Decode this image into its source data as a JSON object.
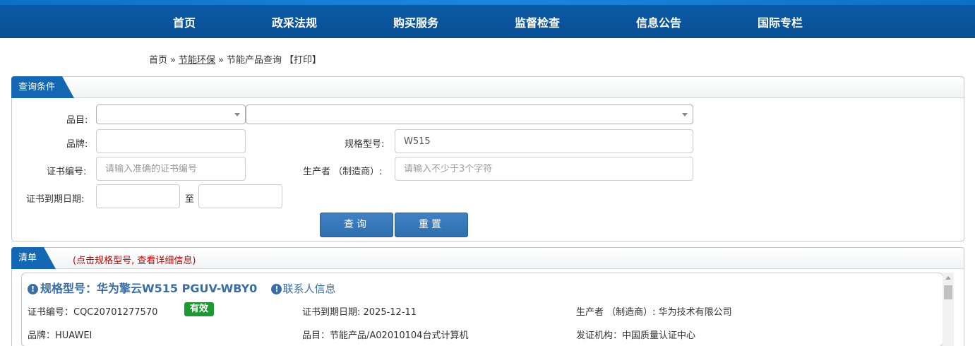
{
  "nav": {
    "items": [
      "首页",
      "政采法规",
      "购买服务",
      "监督检查",
      "信息公告",
      "国际专栏"
    ]
  },
  "breadcrumb": {
    "home": "首页",
    "sep": "»",
    "section": "节能环保",
    "current": "节能产品查询",
    "print": "【打印】"
  },
  "query": {
    "tab": "查询条件",
    "category_label": "品目:",
    "brand_label": "品牌:",
    "model_label": "规格型号:",
    "model_value": "W515",
    "cert_label": "证书编号:",
    "cert_placeholder": "请输入准确的证书编号",
    "maker_label": "生产者 （制造商）:",
    "maker_placeholder": "请输入不少于3个字符",
    "date_label": "证书到期日期:",
    "date_to": "至",
    "search_button": "查询",
    "reset_button": "重置"
  },
  "list": {
    "tab": "清单",
    "hint": "(点击规格型号, 查看详细信息)",
    "items": [
      {
        "model": "规格型号：华为擎云W515 PGUV-WBY0",
        "contact": "联系人信息",
        "cert_no": "证书编号：CQC20701277570",
        "status": "有效",
        "expire": "证书到期日期: 2025-12-11",
        "maker": "生产者 （制造商）: 华为技术有限公司",
        "brand": "品牌：HUAWEI",
        "category": "品目：节能产品/A02010104台式计算机",
        "issuer": "发证机构：中国质量认证中心"
      }
    ]
  },
  "colors": {
    "nav_bg": "#0a5aa6",
    "tab_bg": "#1467b3",
    "button_bg": "#3478b8",
    "link_blue": "#3a6ea5",
    "status_green": "#1e9a35",
    "hint_red": "#cc0000"
  },
  "icons": {
    "info": "info-circle-icon",
    "dropdown": "chevron-down-icon"
  }
}
